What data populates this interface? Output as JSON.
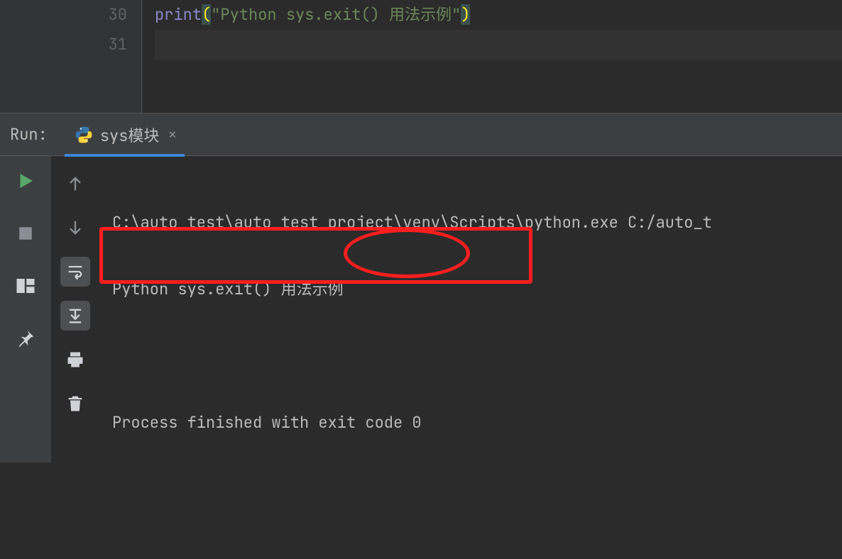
{
  "editor": {
    "lines": [
      {
        "num": "30",
        "func": "print",
        "str": "\"Python sys.exit() 用法示例\""
      },
      {
        "num": "31"
      }
    ]
  },
  "run": {
    "label": "Run:",
    "tab": "sys模块",
    "close": "×"
  },
  "console": {
    "line1": "C:\\auto_test\\auto_test_project\\venv\\Scripts\\python.exe C:/auto_t",
    "line2": "Python sys.exit() 用法示例",
    "line3": "",
    "line4": "Process finished with exit code 0"
  },
  "icons": {
    "run_green": "run",
    "stop": "stop",
    "layout": "layout",
    "pin": "pin",
    "up": "up",
    "down": "down",
    "wrap": "wrap",
    "scroll_end": "scroll-end",
    "print": "print",
    "trash": "trash"
  }
}
